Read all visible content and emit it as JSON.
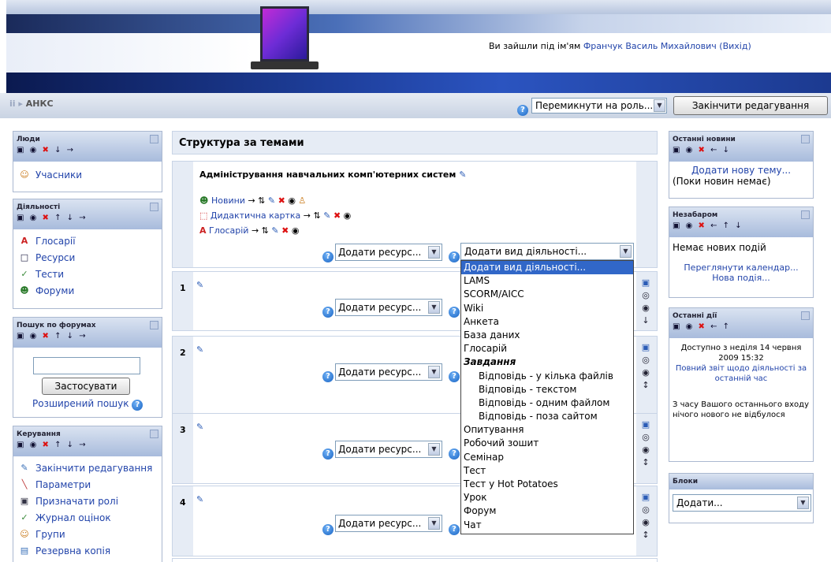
{
  "header": {
    "login_text": "Ви зайшли під ім'ям",
    "user_name": "Франчук Василь Михайлович",
    "logout_label": "(Вихід)"
  },
  "navbar": {
    "breadcrumb_prefix": "ii ▸",
    "breadcrumb": "АНКС",
    "role_select": "Перемикнути на роль...",
    "end_edit_button": "Закінчити редагування"
  },
  "left": {
    "people": {
      "title": "Люди",
      "items": [
        "Учасники"
      ]
    },
    "activities": {
      "title": "Діяльності",
      "items": [
        "Глосарії",
        "Ресурси",
        "Тести",
        "Форуми"
      ]
    },
    "search": {
      "title": "Пошук по форумах",
      "button": "Застосувати",
      "advanced": "Розширений пошук"
    },
    "admin": {
      "title": "Керування",
      "items": [
        "Закінчити редагування",
        "Параметри",
        "Призначати ролі",
        "Журнал оцінок",
        "Групи",
        "Резервна копія"
      ]
    }
  },
  "center": {
    "title": "Структура за темами",
    "section0": {
      "summary": "Адміністрування навчальних комп'ютерних систем",
      "resources": [
        "Новини",
        "Дидактична картка",
        "Глосарій"
      ]
    },
    "sections": [
      "1",
      "2",
      "3",
      "4"
    ],
    "add_resource": "Додати ресурс...",
    "add_activity": "Додати вид діяльності...",
    "activity_options": [
      {
        "label": "Додати вид діяльності...",
        "kind": "sel"
      },
      {
        "label": "LAMS",
        "kind": ""
      },
      {
        "label": "SCORM/AICC",
        "kind": ""
      },
      {
        "label": "Wiki",
        "kind": ""
      },
      {
        "label": "Анкета",
        "kind": ""
      },
      {
        "label": "База даних",
        "kind": ""
      },
      {
        "label": "Глосарій",
        "kind": ""
      },
      {
        "label": "Завдання",
        "kind": "grp"
      },
      {
        "label": "Відповідь - у кілька файлів",
        "kind": "sub"
      },
      {
        "label": "Відповідь - текстом",
        "kind": "sub"
      },
      {
        "label": "Відповідь - одним файлом",
        "kind": "sub"
      },
      {
        "label": "Відповідь - поза сайтом",
        "kind": "sub"
      },
      {
        "label": "Опитування",
        "kind": ""
      },
      {
        "label": "Робочий зошит",
        "kind": ""
      },
      {
        "label": "Семінар",
        "kind": ""
      },
      {
        "label": "Тест",
        "kind": ""
      },
      {
        "label": "Тест у Hot Potatoes",
        "kind": ""
      },
      {
        "label": "Урок",
        "kind": ""
      },
      {
        "label": "Форум",
        "kind": ""
      },
      {
        "label": "Чат",
        "kind": ""
      }
    ]
  },
  "right": {
    "news": {
      "title": "Останні новини",
      "add": "Додати нову тему...",
      "empty": "(Поки новин немає)"
    },
    "upcoming": {
      "title": "Незабаром",
      "empty": "Немає нових подій",
      "calendar": "Переглянути календар...",
      "new_event": "Нова подія..."
    },
    "recent": {
      "title": "Останні дії",
      "since_1": "Доступно з неділя 14 червня",
      "since_2": "2009 15:32",
      "report": "Повний звіт щодо діяльності за останній час",
      "nothing": "З часу Вашого останнього входу нічого нового не відбулося"
    },
    "blocks": {
      "title": "Блоки",
      "add": "Додати..."
    }
  }
}
